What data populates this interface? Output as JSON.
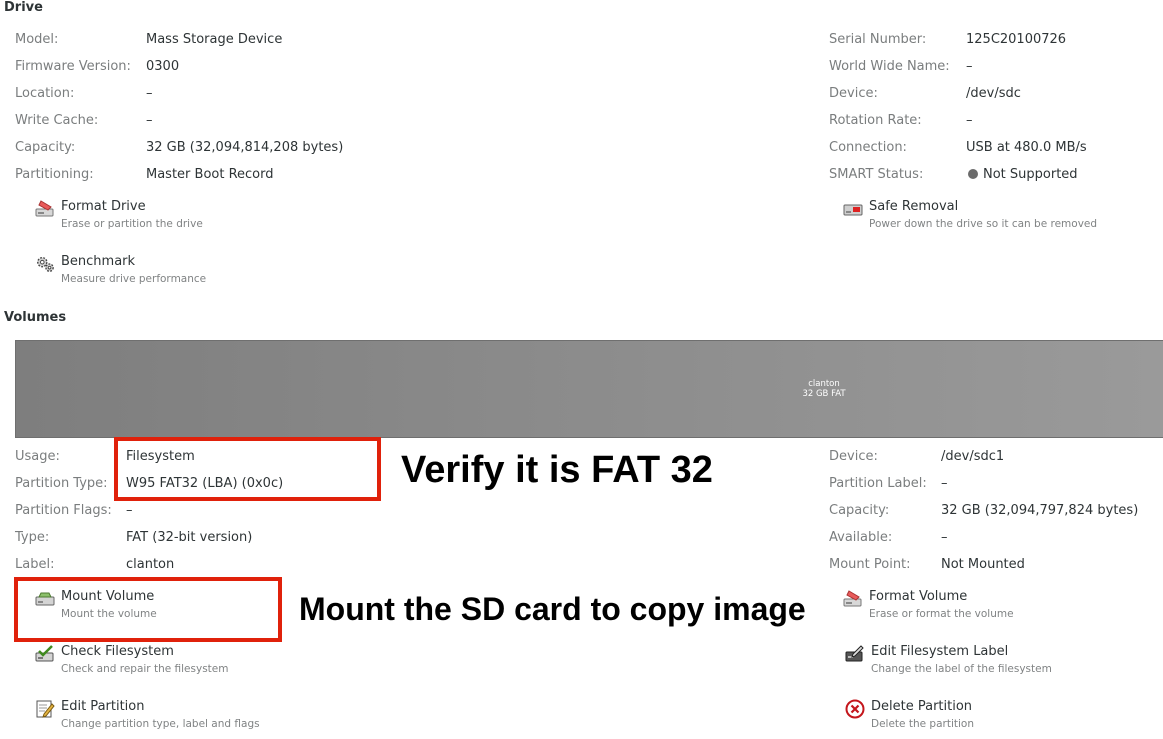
{
  "drive": {
    "title": "Drive",
    "left": [
      {
        "label": "Model:",
        "value": "Mass Storage Device"
      },
      {
        "label": "Firmware Version:",
        "value": "0300"
      },
      {
        "label": "Location:",
        "value": "–"
      },
      {
        "label": "Write Cache:",
        "value": "–"
      },
      {
        "label": "Capacity:",
        "value": "32 GB (32,094,814,208 bytes)"
      },
      {
        "label": "Partitioning:",
        "value": "Master Boot Record"
      }
    ],
    "right": [
      {
        "label": "Serial Number:",
        "value": "125C20100726"
      },
      {
        "label": "World Wide Name:",
        "value": "–"
      },
      {
        "label": "Device:",
        "value": "/dev/sdc"
      },
      {
        "label": "Rotation Rate:",
        "value": "–"
      },
      {
        "label": "Connection:",
        "value": "USB at 480.0 MB/s"
      },
      {
        "label": "SMART Status:",
        "value": "Not Supported"
      }
    ],
    "actions": {
      "format": {
        "title": "Format Drive",
        "subtitle": "Erase or partition the drive",
        "icon": "format-drive-icon"
      },
      "benchmark": {
        "title": "Benchmark",
        "subtitle": "Measure drive performance",
        "icon": "gears-icon"
      },
      "safe_removal": {
        "title": "Safe Removal",
        "subtitle": "Power down the drive so it can be removed",
        "icon": "eject-drive-icon"
      }
    }
  },
  "volumes": {
    "title": "Volumes",
    "bar": {
      "name": "clanton",
      "detail": "32 GB FAT"
    },
    "left": [
      {
        "label": "Usage:",
        "value": "Filesystem"
      },
      {
        "label": "Partition Type:",
        "value": "W95 FAT32 (LBA) (0x0c)"
      },
      {
        "label": "Partition Flags:",
        "value": "–"
      },
      {
        "label": "Type:",
        "value": "FAT (32-bit version)"
      },
      {
        "label": "Label:",
        "value": "clanton"
      }
    ],
    "right": [
      {
        "label": "Device:",
        "value": "/dev/sdc1"
      },
      {
        "label": "Partition Label:",
        "value": "–"
      },
      {
        "label": "Capacity:",
        "value": "32 GB (32,094,797,824 bytes)"
      },
      {
        "label": "Available:",
        "value": "–"
      },
      {
        "label": "Mount Point:",
        "value": "Not Mounted"
      }
    ],
    "actions": {
      "mount": {
        "title": "Mount Volume",
        "subtitle": "Mount the volume",
        "icon": "mount-icon"
      },
      "check": {
        "title": "Check Filesystem",
        "subtitle": "Check and repair the filesystem",
        "icon": "check-filesystem-icon"
      },
      "edit_partition": {
        "title": "Edit Partition",
        "subtitle": "Change partition type, label and flags",
        "icon": "edit-partition-icon"
      },
      "format_volume": {
        "title": "Format Volume",
        "subtitle": "Erase or format the volume",
        "icon": "format-volume-icon"
      },
      "edit_label": {
        "title": "Edit Filesystem Label",
        "subtitle": "Change the label of the filesystem",
        "icon": "edit-label-icon"
      },
      "delete": {
        "title": "Delete Partition",
        "subtitle": "Delete the partition",
        "icon": "delete-icon"
      }
    }
  },
  "annotations": {
    "verify": "Verify it is FAT 32",
    "mount": "Mount the SD card to copy image"
  },
  "colors": {
    "callout": "#e0210b",
    "volume_bar": "#8c8c8c"
  }
}
